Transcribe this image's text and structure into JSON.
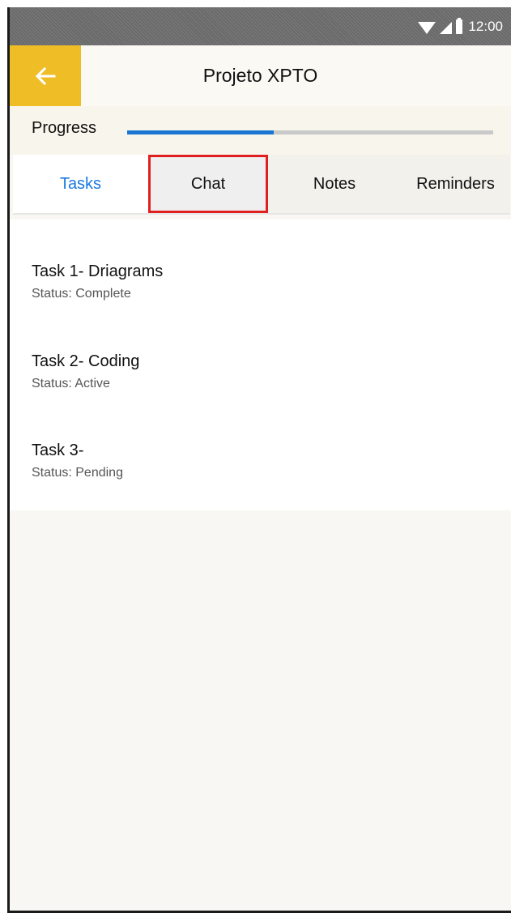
{
  "status_bar": {
    "time": "12:00",
    "icons": [
      "wifi-icon",
      "signal-icon",
      "battery-icon"
    ]
  },
  "app_bar": {
    "back_icon": "arrow-left-icon",
    "title": "Projeto XPTO",
    "accent_color": "#efbe27"
  },
  "progress": {
    "label": "Progress",
    "value_fraction": 0.4,
    "fill_color": "#1976d2"
  },
  "tabs": [
    {
      "label": "Tasks",
      "active": true
    },
    {
      "label": "Chat",
      "highlighted": true
    },
    {
      "label": "Notes"
    },
    {
      "label": "Reminders"
    }
  ],
  "tasks": [
    {
      "title": "Task 1- Driagrams",
      "status": "Status: Complete"
    },
    {
      "title": "Task 2- Coding",
      "status": "Status: Active"
    },
    {
      "title": "Task 3-",
      "status": "Status: Pending"
    }
  ],
  "colors": {
    "active_tab": "#1a79e0",
    "highlight_border": "#e02020"
  }
}
